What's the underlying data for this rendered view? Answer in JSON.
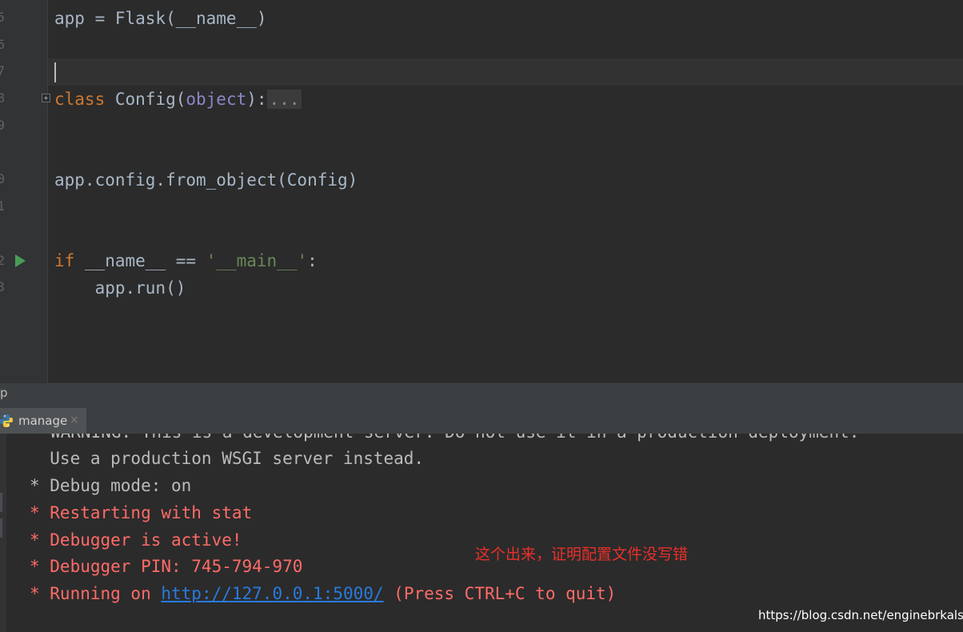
{
  "editor": {
    "line_numbers": [
      "5",
      "6",
      "7",
      "8",
      "9",
      "0",
      "1",
      "2",
      "3"
    ],
    "code": {
      "line_app": {
        "a": "app = Flask(__name__)"
      },
      "line_class": {
        "kw": "class",
        "name": " Config(",
        "base": "object",
        "tail": "):",
        "fold": "..."
      },
      "line_config": "app.config.from_object(Config)",
      "line_if": {
        "kw": "if",
        "mid": " __name__ == ",
        "str": "'__main__'",
        "tail": ":"
      },
      "line_run": "    app.run()"
    }
  },
  "run_panel": {
    "header_label": "p",
    "tab_label": "manage",
    "tab_close": "×",
    "output": [
      "WARNING: This is a development server. Do not use it in a production deployment.",
      "  Use a production WSGI server instead.",
      "* Debug mode: on",
      "* Restarting with stat",
      "* Debugger is active!",
      "* Debugger PIN: 745-794-970",
      "* Running on ",
      "http://127.0.0.1:5000/",
      " (Press CTRL+C to quit)"
    ]
  },
  "annotation": "这个出来，证明配置文件没写错",
  "watermark": "https://blog.csdn.net/enginebrkalsy",
  "colors": {
    "background": "#2b2b2b",
    "keyword": "#cc7832",
    "string": "#6a8759",
    "console_red": "#ff6b68",
    "link": "#287bde",
    "annotation": "#e8302a"
  }
}
